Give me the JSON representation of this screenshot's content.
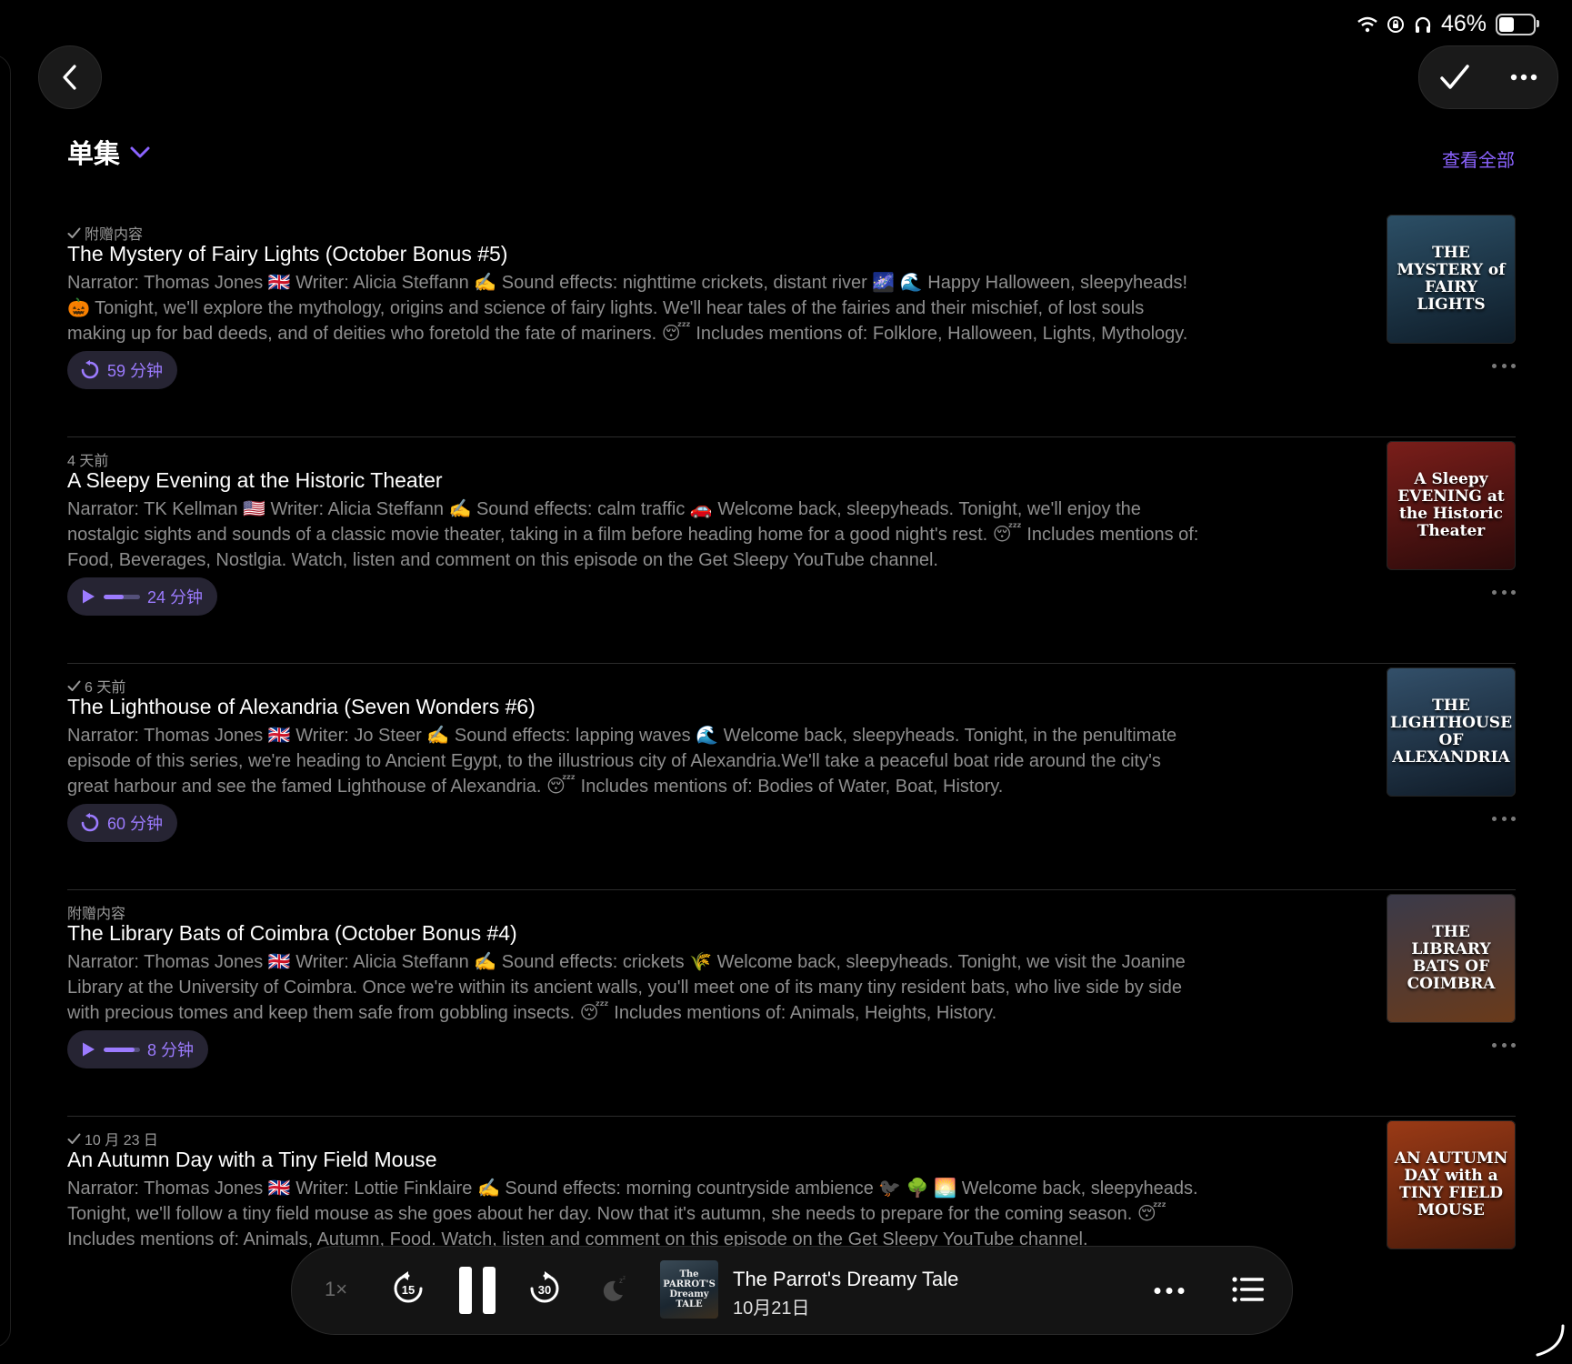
{
  "status_bar": {
    "battery_percent": "46%"
  },
  "section": {
    "title": "单集",
    "see_all": "查看全部"
  },
  "episodes": [
    {
      "played": true,
      "meta": "附赠内容",
      "title": "The Mystery of Fairy Lights (October Bonus #5)",
      "description": "Narrator: Thomas Jones 🇬🇧 Writer: Alicia Steffann ✍️ Sound effects: nighttime crickets, distant river 🌌 🌊   Happy Halloween, sleepyheads! 🎃  Tonight, we'll explore the mythology, origins and science of fairy lights. We'll hear tales of the fairies and their mischief, of lost souls making up for bad deeds, and of deities who foretold the fate of mariners. 😴   Includes mentions of: Folklore, Halloween, Lights, Mythology.",
      "button_type": "replay",
      "duration": "59 分钟",
      "progress": 0,
      "art_text": "THE MYSTERY of FAIRY LIGHTS",
      "art_colors": [
        "#2c4f66",
        "#0e1c28"
      ]
    },
    {
      "played": false,
      "meta": "4 天前",
      "title": "A Sleepy Evening at the Historic Theater",
      "description": "Narrator: TK Kellman 🇺🇸 Writer: Alicia Steffann ✍️ Sound effects: calm traffic 🚗   Welcome back, sleepyheads. Tonight, we'll enjoy the nostalgic sights and sounds of a classic movie theater, taking in a film before heading home for a good night's rest. 😴   Includes mentions of: Food, Beverages, Nostlgia.   Watch, listen and comment on this episode on the Get Sleepy YouTube channel.",
      "button_type": "play",
      "duration": "24 分钟",
      "progress": 0.55,
      "art_text": "A Sleepy EVENING at the Historic Theater",
      "art_colors": [
        "#7a1e1a",
        "#2a0a0a"
      ]
    },
    {
      "played": true,
      "meta": "6 天前",
      "title": "The Lighthouse of Alexandria (Seven Wonders #6)",
      "description": "Narrator: Thomas Jones 🇬🇧 Writer: Jo Steer ✍️ Sound effects: lapping waves 🌊   Welcome back, sleepyheads. Tonight, in the penultimate episode of this series, we're heading to Ancient Egypt, to the illustrious city of Alexandria.We'll take a peaceful boat ride around the city's great harbour and see the famed Lighthouse of Alexandria. 😴   Includes mentions of: Bodies of Water, Boat, History.",
      "button_type": "replay",
      "duration": "60 分钟",
      "progress": 0,
      "art_text": "THE LIGHTHOUSE OF ALEXANDRIA",
      "art_colors": [
        "#33506a",
        "#0f1a26"
      ]
    },
    {
      "played": false,
      "meta": "附赠内容",
      "title": "The Library Bats of Coimbra (October Bonus #4)",
      "description": "Narrator: Thomas Jones 🇬🇧 Writer: Alicia Steffann ✍️ Sound effects: crickets 🌾   Welcome back, sleepyheads. Tonight, we visit the Joanine Library at the University of Coimbra. Once we're within its ancient walls, you'll meet one of its many tiny resident bats, who live side by side with precious tomes and keep them safe from gobbling insects. 😴   Includes mentions of: Animals, Heights, History.",
      "button_type": "play",
      "duration": "8 分钟",
      "progress": 0.85,
      "art_text": "THE LIBRARY BATS OF COIMBRA",
      "art_colors": [
        "#3a3a4a",
        "#6a3a1a"
      ]
    },
    {
      "played": true,
      "meta": "10 月 23 日",
      "title": "An Autumn Day with a Tiny Field Mouse",
      "description": "Narrator: Thomas Jones 🇬🇧 Writer: Lottie Finklaire ✍️ Sound effects: morning countryside ambience 🐦‍⬛ 🌳 🌅   Welcome back, sleepyheads. Tonight, we'll follow a tiny field mouse as she goes about her day. Now that it's autumn, she needs to prepare for the coming season. 😴   Includes mentions of: Animals, Autumn, Food.   Watch, listen and comment on this episode on the Get Sleepy YouTube channel.",
      "button_type": "none",
      "duration": "",
      "progress": 0,
      "art_text": "AN AUTUMN DAY with a TINY FIELD MOUSE",
      "art_colors": [
        "#9a3a16",
        "#4a1a0a"
      ]
    }
  ],
  "player": {
    "speed": "1×",
    "skip_back": "15",
    "skip_forward": "30",
    "title": "The Parrot's Dreamy Tale",
    "date": "10月21日",
    "art_text": "The PARROT'S Dreamy TALE"
  }
}
